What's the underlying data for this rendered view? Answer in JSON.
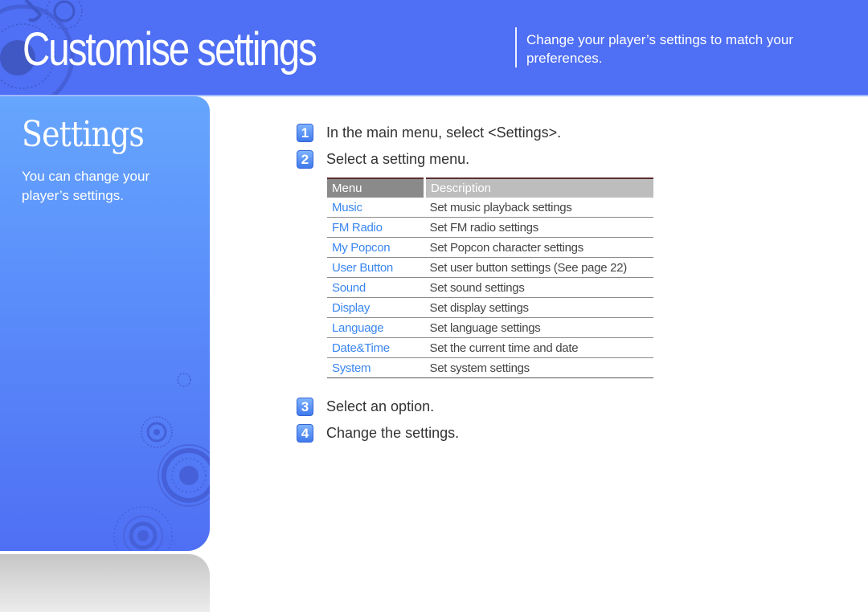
{
  "header": {
    "title": "Customise settings",
    "subtitle": "Change your player’s settings to match your preferences.",
    "background_color": "#4f6ff4"
  },
  "sidebar": {
    "title": "Settings",
    "description": "You can change your player’s settings."
  },
  "steps": [
    {
      "number": "1",
      "text": "In the main menu, select <Settings>."
    },
    {
      "number": "2",
      "text": "Select a setting menu."
    },
    {
      "number": "3",
      "text": "Select an option."
    },
    {
      "number": "4",
      "text": "Change the settings."
    }
  ],
  "table": {
    "headers": [
      "Menu",
      "Description"
    ],
    "rows": [
      {
        "menu": "Music",
        "description": "Set music playback settings"
      },
      {
        "menu": "FM Radio",
        "description": "Set FM radio settings"
      },
      {
        "menu": "My Popcon",
        "description": "Set Popcon character settings"
      },
      {
        "menu": "User Button",
        "description": "Set user button settings (See page 22)"
      },
      {
        "menu": "Sound",
        "description": "Set sound settings"
      },
      {
        "menu": "Display",
        "description": "Set display settings"
      },
      {
        "menu": "Language",
        "description": "Set language settings"
      },
      {
        "menu": "Date&Time",
        "description": "Set the current time and date"
      },
      {
        "menu": "System",
        "description": "Set system settings"
      }
    ],
    "link_color": "#3a86f0"
  }
}
